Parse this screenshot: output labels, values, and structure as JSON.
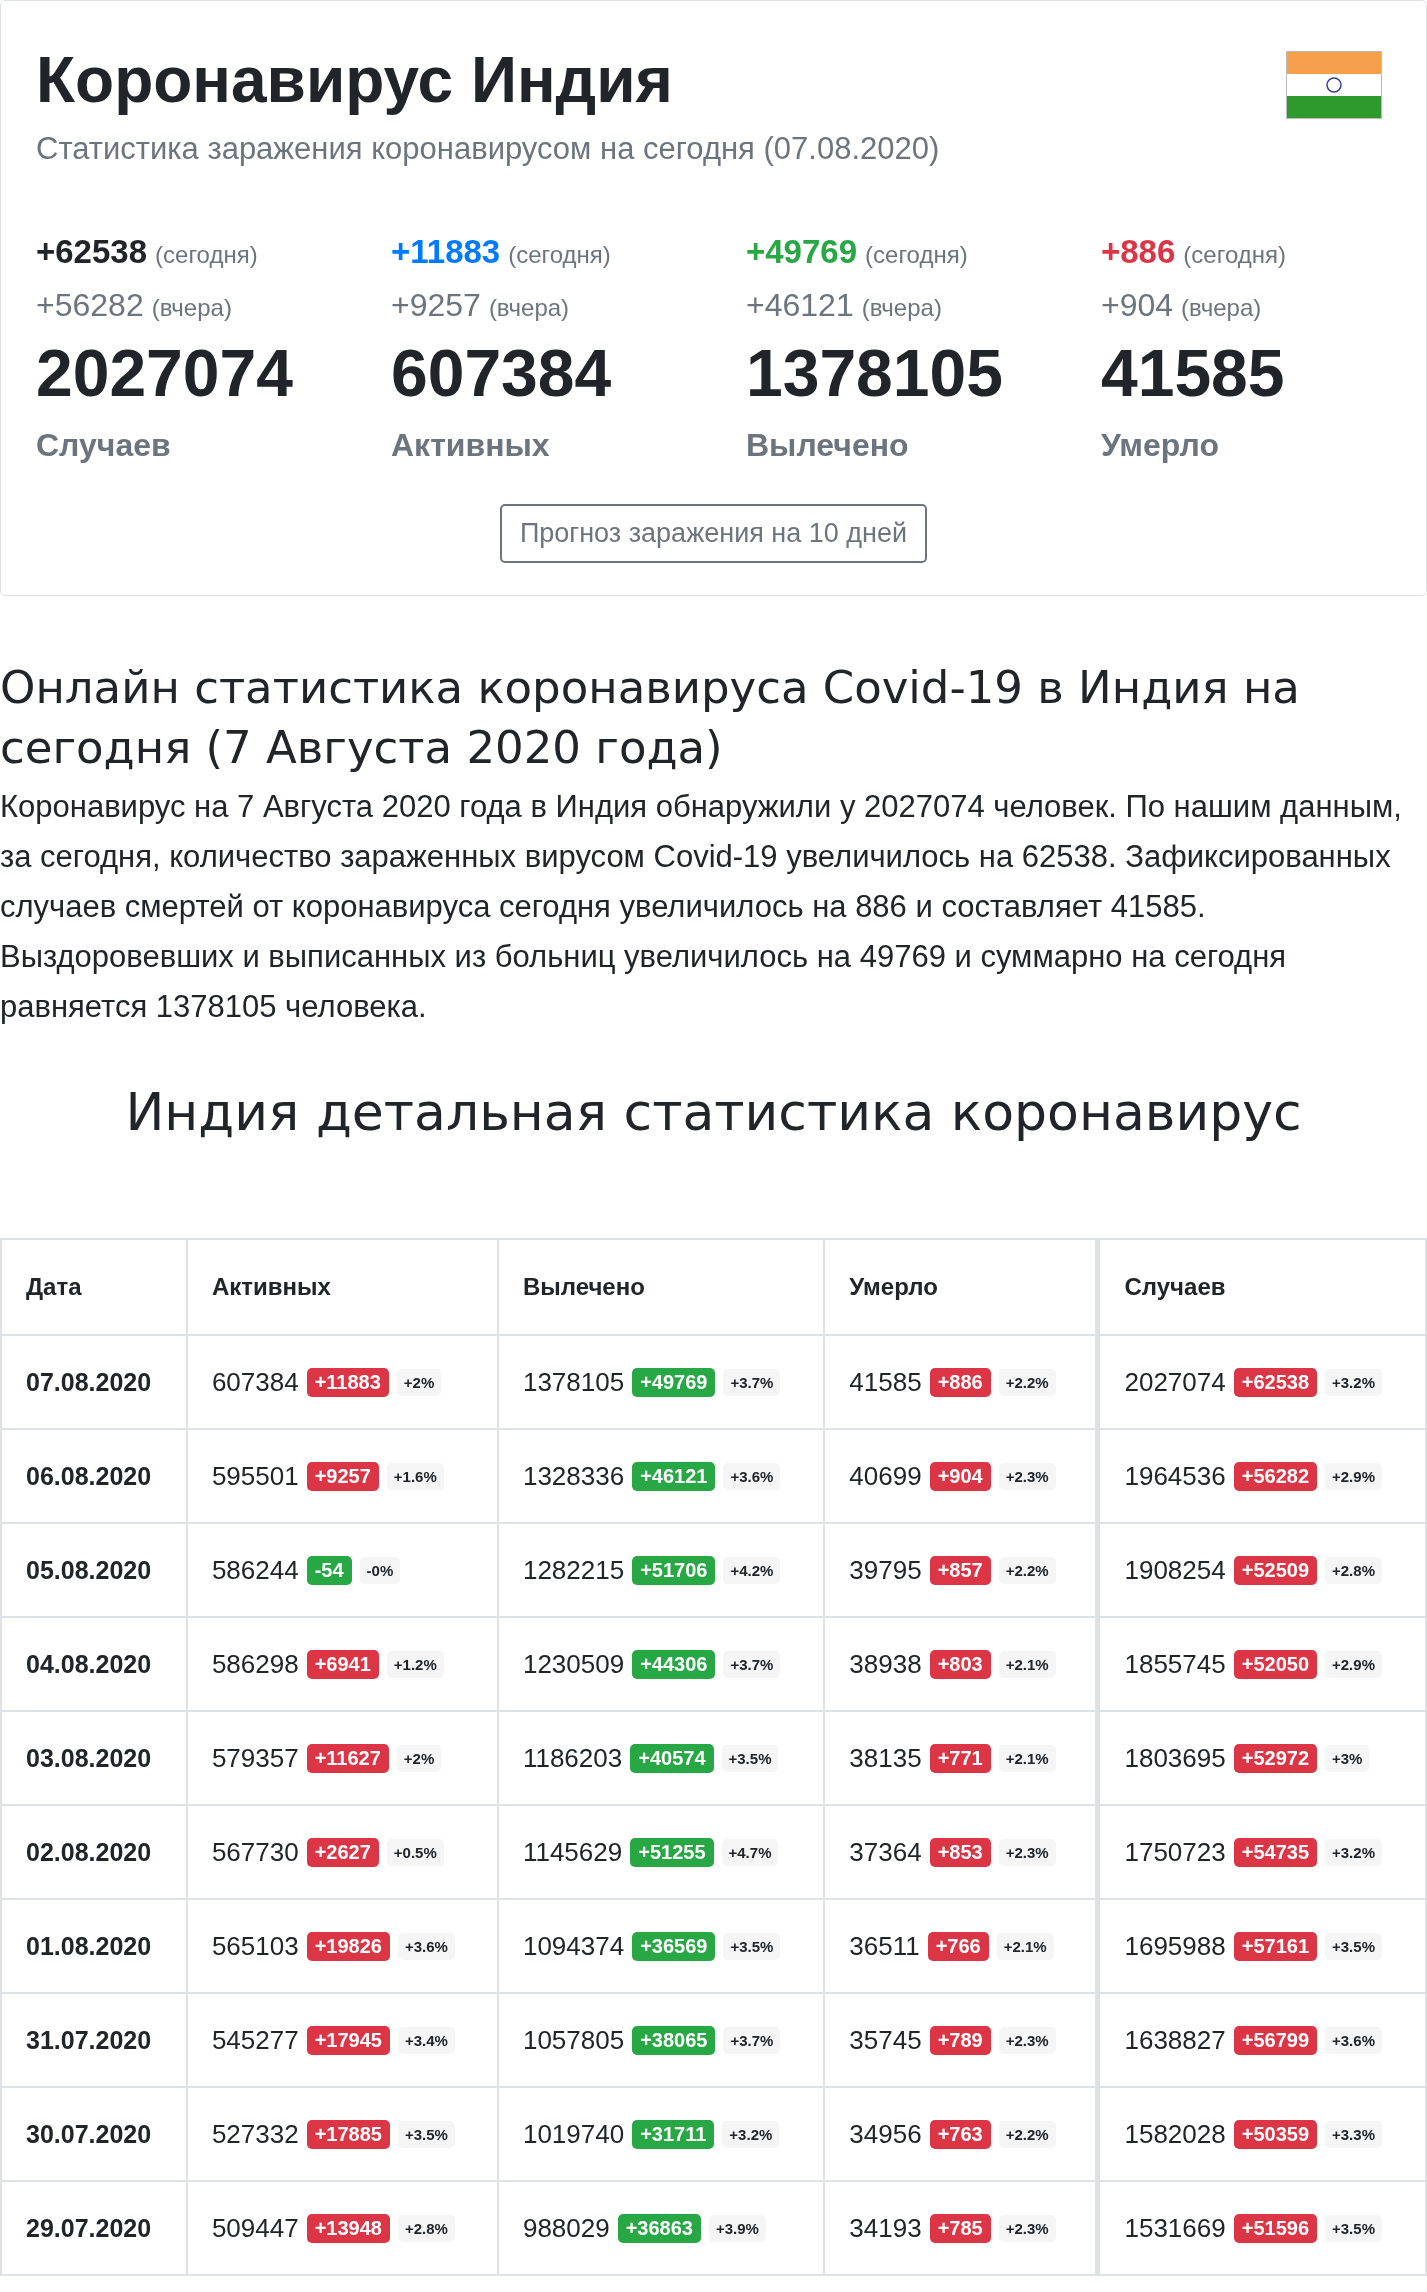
{
  "header": {
    "title": "Коронавирус Индия",
    "subtitle": "Статистика заражения коронавирусом на сегодня (07.08.2020)",
    "stats": [
      {
        "today": "+62538",
        "today_label": "(сегодня)",
        "yesterday": "+56282",
        "yesterday_label": "(вчера)",
        "total": "2027074",
        "label": "Случаев",
        "color": "#212529"
      },
      {
        "today": "+11883",
        "today_label": "(сегодня)",
        "yesterday": "+9257",
        "yesterday_label": "(вчера)",
        "total": "607384",
        "label": "Активных",
        "color": "#007bff"
      },
      {
        "today": "+49769",
        "today_label": "(сегодня)",
        "yesterday": "+46121",
        "yesterday_label": "(вчера)",
        "total": "1378105",
        "label": "Вылечено",
        "color": "#28a745"
      },
      {
        "today": "+886",
        "today_label": "(сегодня)",
        "yesterday": "+904",
        "yesterday_label": "(вчера)",
        "total": "41585",
        "label": "Умерло",
        "color": "#dc3545"
      }
    ],
    "button": "Прогноз заражения на 10 дней"
  },
  "article": {
    "heading": "Онлайн статистика коронавируса Covid-19 в Индия на сегодня (7 Августа 2020 года)",
    "paragraph": "Коронавирус на 7 Августа 2020 года в Индия обнаружили у 2027074 человек. По нашим данным, за сегодня, количество зараженных вирусом Covid-19 увеличилось на 62538. Зафиксированных случаев смертей от коронавируса сегодня увеличилось на 886 и составляет 41585. Выздоровевших и выписанных из больниц увеличилось на 49769 и суммарно на сегодня равняется 1378105 человека."
  },
  "table": {
    "title": "Индия детальная статистика коронавирус",
    "columns": [
      "Дата",
      "Активных",
      "Вылечено",
      "Умерло",
      "Случаев"
    ],
    "rows": [
      {
        "cells": [
          {
            "kind": "date",
            "value": "07.08.2020"
          },
          {
            "value": "607384",
            "change": "+11883",
            "color": "#dc3545",
            "percent": "+2%"
          },
          {
            "value": "1378105",
            "change": "+49769",
            "color": "#28a745",
            "percent": "+3.7%"
          },
          {
            "value": "41585",
            "change": "+886",
            "color": "#dc3545",
            "percent": "+2.2%"
          },
          {
            "value": "2027074",
            "change": "+62538",
            "color": "#dc3545",
            "percent": "+3.2%"
          }
        ]
      },
      {
        "cells": [
          {
            "kind": "date",
            "value": "06.08.2020"
          },
          {
            "value": "595501",
            "change": "+9257",
            "color": "#dc3545",
            "percent": "+1.6%"
          },
          {
            "value": "1328336",
            "change": "+46121",
            "color": "#28a745",
            "percent": "+3.6%"
          },
          {
            "value": "40699",
            "change": "+904",
            "color": "#dc3545",
            "percent": "+2.3%"
          },
          {
            "value": "1964536",
            "change": "+56282",
            "color": "#dc3545",
            "percent": "+2.9%"
          }
        ]
      },
      {
        "cells": [
          {
            "kind": "date",
            "value": "05.08.2020"
          },
          {
            "value": "586244",
            "change": "-54",
            "color": "#28a745",
            "percent": "-0%"
          },
          {
            "value": "1282215",
            "change": "+51706",
            "color": "#28a745",
            "percent": "+4.2%"
          },
          {
            "value": "39795",
            "change": "+857",
            "color": "#dc3545",
            "percent": "+2.2%"
          },
          {
            "value": "1908254",
            "change": "+52509",
            "color": "#dc3545",
            "percent": "+2.8%"
          }
        ]
      },
      {
        "cells": [
          {
            "kind": "date",
            "value": "04.08.2020"
          },
          {
            "value": "586298",
            "change": "+6941",
            "color": "#dc3545",
            "percent": "+1.2%"
          },
          {
            "value": "1230509",
            "change": "+44306",
            "color": "#28a745",
            "percent": "+3.7%"
          },
          {
            "value": "38938",
            "change": "+803",
            "color": "#dc3545",
            "percent": "+2.1%"
          },
          {
            "value": "1855745",
            "change": "+52050",
            "color": "#dc3545",
            "percent": "+2.9%"
          }
        ]
      },
      {
        "cells": [
          {
            "kind": "date",
            "value": "03.08.2020"
          },
          {
            "value": "579357",
            "change": "+11627",
            "color": "#dc3545",
            "percent": "+2%"
          },
          {
            "value": "1186203",
            "change": "+40574",
            "color": "#28a745",
            "percent": "+3.5%"
          },
          {
            "value": "38135",
            "change": "+771",
            "color": "#dc3545",
            "percent": "+2.1%"
          },
          {
            "value": "1803695",
            "change": "+52972",
            "color": "#dc3545",
            "percent": "+3%"
          }
        ]
      },
      {
        "cells": [
          {
            "kind": "date",
            "value": "02.08.2020"
          },
          {
            "value": "567730",
            "change": "+2627",
            "color": "#dc3545",
            "percent": "+0.5%"
          },
          {
            "value": "1145629",
            "change": "+51255",
            "color": "#28a745",
            "percent": "+4.7%"
          },
          {
            "value": "37364",
            "change": "+853",
            "color": "#dc3545",
            "percent": "+2.3%"
          },
          {
            "value": "1750723",
            "change": "+54735",
            "color": "#dc3545",
            "percent": "+3.2%"
          }
        ]
      },
      {
        "cells": [
          {
            "kind": "date",
            "value": "01.08.2020"
          },
          {
            "value": "565103",
            "change": "+19826",
            "color": "#dc3545",
            "percent": "+3.6%"
          },
          {
            "value": "1094374",
            "change": "+36569",
            "color": "#28a745",
            "percent": "+3.5%"
          },
          {
            "value": "36511",
            "change": "+766",
            "color": "#dc3545",
            "percent": "+2.1%"
          },
          {
            "value": "1695988",
            "change": "+57161",
            "color": "#dc3545",
            "percent": "+3.5%"
          }
        ]
      },
      {
        "cells": [
          {
            "kind": "date",
            "value": "31.07.2020"
          },
          {
            "value": "545277",
            "change": "+17945",
            "color": "#dc3545",
            "percent": "+3.4%"
          },
          {
            "value": "1057805",
            "change": "+38065",
            "color": "#28a745",
            "percent": "+3.7%"
          },
          {
            "value": "35745",
            "change": "+789",
            "color": "#dc3545",
            "percent": "+2.3%"
          },
          {
            "value": "1638827",
            "change": "+56799",
            "color": "#dc3545",
            "percent": "+3.6%"
          }
        ]
      },
      {
        "cells": [
          {
            "kind": "date",
            "value": "30.07.2020"
          },
          {
            "value": "527332",
            "change": "+17885",
            "color": "#dc3545",
            "percent": "+3.5%"
          },
          {
            "value": "1019740",
            "change": "+31711",
            "color": "#28a745",
            "percent": "+3.2%"
          },
          {
            "value": "34956",
            "change": "+763",
            "color": "#dc3545",
            "percent": "+2.2%"
          },
          {
            "value": "1582028",
            "change": "+50359",
            "color": "#dc3545",
            "percent": "+3.3%"
          }
        ]
      },
      {
        "cells": [
          {
            "kind": "date",
            "value": "29.07.2020"
          },
          {
            "value": "509447",
            "change": "+13948",
            "color": "#dc3545",
            "percent": "+2.8%"
          },
          {
            "value": "988029",
            "change": "+36863",
            "color": "#28a745",
            "percent": "+3.9%"
          },
          {
            "value": "34193",
            "change": "+785",
            "color": "#dc3545",
            "percent": "+2.3%"
          },
          {
            "value": "1531669",
            "change": "+51596",
            "color": "#dc3545",
            "percent": "+3.5%"
          }
        ]
      }
    ]
  }
}
